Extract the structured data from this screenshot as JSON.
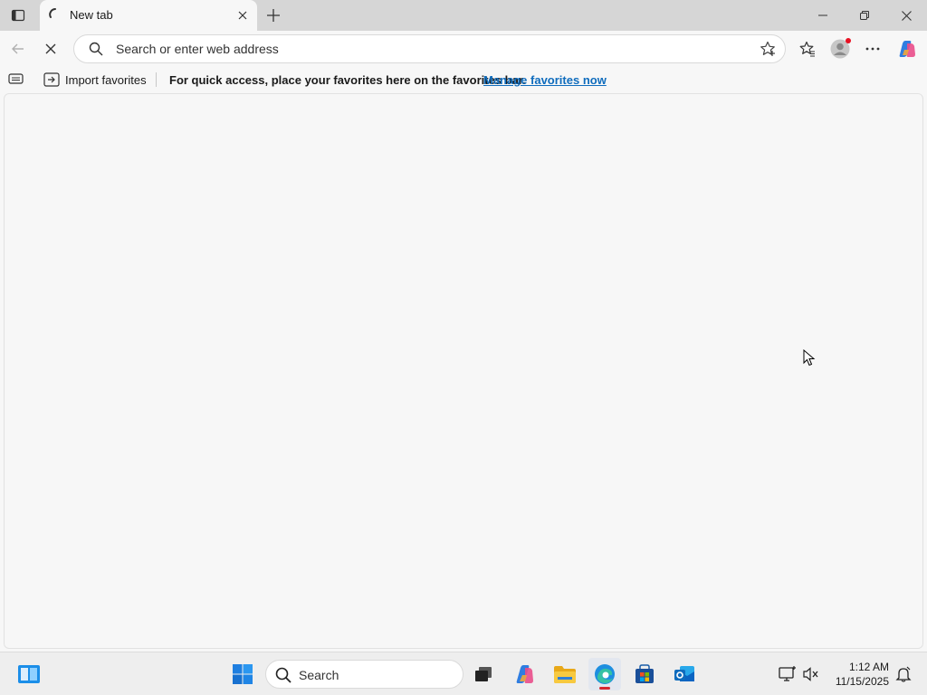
{
  "browser": {
    "tab": {
      "title": "New tab"
    },
    "address_bar": {
      "placeholder": "Search or enter web address"
    },
    "favorites_bar": {
      "import_label": "Import favorites",
      "message": "For quick access, place your favorites here on the favorites bar.",
      "manage_link": "Manage favorites now"
    }
  },
  "taskbar": {
    "search_placeholder": "Search",
    "time": "1:12 AM",
    "date": "11/15/2025"
  },
  "colors": {
    "accent": "#0f6cbd",
    "notification_dot": "#e81123",
    "active_indicator": "#d6272f"
  }
}
